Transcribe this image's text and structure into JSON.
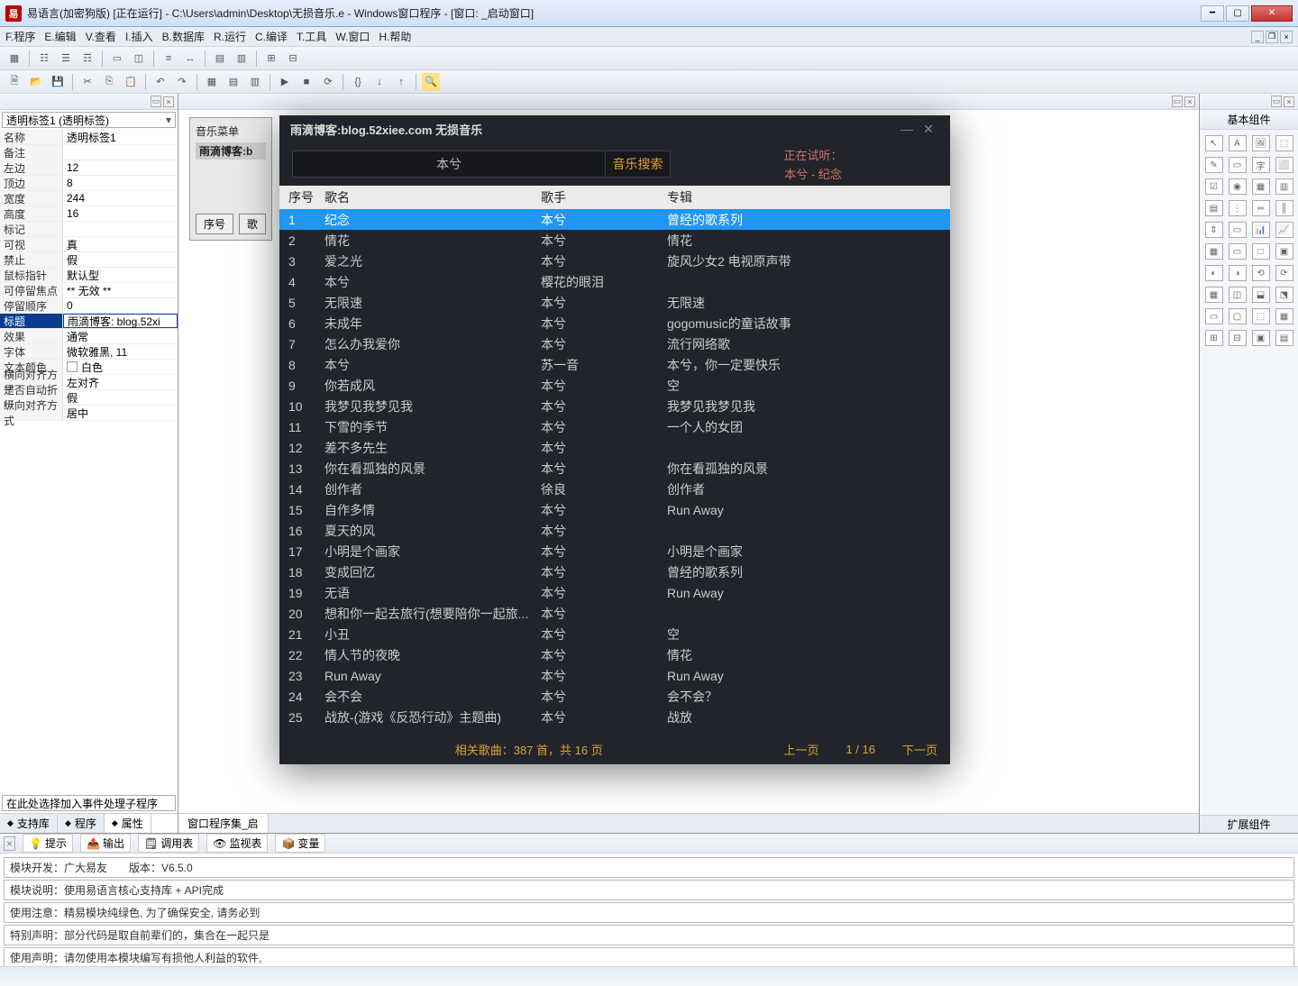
{
  "titlebar": {
    "icon_text": "易",
    "title": "易语言(加密狗版) [正在运行] - C:\\Users\\admin\\Desktop\\无损音乐.e - Windows窗口程序 - [窗口: _启动窗口]"
  },
  "menubar": {
    "items": [
      "F.程序",
      "E.编辑",
      "V.查看",
      "I.插入",
      "B.数据库",
      "R.运行",
      "C.编译",
      "T.工具",
      "W.窗口",
      "H.帮助"
    ]
  },
  "left_panel": {
    "combo": "透明标签1 (透明标签)",
    "rows": [
      {
        "k": "名称",
        "v": "透明标签1"
      },
      {
        "k": "备注",
        "v": ""
      },
      {
        "k": "左边",
        "v": "12"
      },
      {
        "k": "顶边",
        "v": "8"
      },
      {
        "k": "宽度",
        "v": "244"
      },
      {
        "k": "高度",
        "v": "16"
      },
      {
        "k": "标记",
        "v": ""
      },
      {
        "k": "可视",
        "v": "真"
      },
      {
        "k": "禁止",
        "v": "假"
      },
      {
        "k": "鼠标指针",
        "v": "默认型"
      },
      {
        "k": "可停留焦点",
        "v": "** 无效 **"
      },
      {
        "k": "停留顺序",
        "v": "0"
      },
      {
        "k": "标题",
        "v": "雨滴博客: blog.52xi",
        "sel": true
      },
      {
        "k": "效果",
        "v": "通常"
      },
      {
        "k": "字体",
        "v": "微软雅黑, 11"
      },
      {
        "k": "文本颜色",
        "v": "白色",
        "swatch": "#ffffff"
      },
      {
        "k": "横向对齐方式",
        "v": "左对齐"
      },
      {
        "k": "是否自动折行",
        "v": "假"
      },
      {
        "k": "纵向对齐方式",
        "v": "居中"
      }
    ],
    "bottom_combo": "在此处选择加入事件处理子程序",
    "tabs": [
      "支持库",
      "程序",
      "属性"
    ]
  },
  "center": {
    "design_label1": "音乐菜单",
    "design_label2": "雨滴博客:b",
    "extra": [
      "序号",
      "歌"
    ],
    "tab": "窗口程序集_启"
  },
  "right_palette": {
    "title": "基本组件",
    "count": 40,
    "footer": "扩展组件"
  },
  "bottom": {
    "tabs": [
      "提示",
      "输出",
      "调用表",
      "监视表",
      "变量"
    ],
    "rows": [
      "模块开发：广大易友　　版本：V6.5.0",
      "模块说明：使用易语言核心支持库 + API完成",
      "使用注意：精易模块纯绿色, 为了确保安全, 请务必到",
      "特别声明：部分代码是取自前辈们的，集合在一起只是",
      "使用声明：请勿使用本模块编写有损他人利益的软件,"
    ]
  },
  "player": {
    "title": "雨滴博客:blog.52xiee.com 无损音乐",
    "search_placeholder": "本兮",
    "search_btn": "音乐搜索",
    "now1": "正在试听：",
    "now2": "本兮 - 纪念",
    "headers": {
      "num": "序号",
      "name": "歌名",
      "singer": "歌手",
      "album": "专辑"
    },
    "songs": [
      {
        "n": "1",
        "name": "纪念",
        "singer": "本兮",
        "album": "曾经的歌系列",
        "sel": true
      },
      {
        "n": "2",
        "name": "情花",
        "singer": "本兮",
        "album": "情花"
      },
      {
        "n": "3",
        "name": "爱之光",
        "singer": "本兮",
        "album": "旋风少女2 电视原声带"
      },
      {
        "n": "4",
        "name": "本兮",
        "singer": "樱花的眼泪",
        "album": ""
      },
      {
        "n": "5",
        "name": "无限速",
        "singer": "本兮",
        "album": "无限速"
      },
      {
        "n": "6",
        "name": "未成年",
        "singer": "本兮",
        "album": "gogomusic的童话故事"
      },
      {
        "n": "7",
        "name": "怎么办我爱你",
        "singer": "本兮",
        "album": "流行网络歌"
      },
      {
        "n": "8",
        "name": "本兮",
        "singer": "苏一音",
        "album": "本兮，你一定要快乐"
      },
      {
        "n": "9",
        "name": "你若成风",
        "singer": "本兮",
        "album": "空"
      },
      {
        "n": "10",
        "name": "我梦见我梦见我",
        "singer": "本兮",
        "album": "我梦见我梦见我"
      },
      {
        "n": "11",
        "name": "下雪的季节",
        "singer": "本兮",
        "album": "一个人的女团"
      },
      {
        "n": "12",
        "name": "差不多先生",
        "singer": "本兮",
        "album": ""
      },
      {
        "n": "13",
        "name": "你在看孤独的风景",
        "singer": "本兮",
        "album": "你在看孤独的风景"
      },
      {
        "n": "14",
        "name": "创作者",
        "singer": "徐良",
        "album": "创作者"
      },
      {
        "n": "15",
        "name": "自作多情",
        "singer": "本兮",
        "album": "Run Away"
      },
      {
        "n": "16",
        "name": "夏天的风",
        "singer": "本兮",
        "album": ""
      },
      {
        "n": "17",
        "name": "小明是个画家",
        "singer": "本兮",
        "album": "小明是个画家"
      },
      {
        "n": "18",
        "name": "变成回忆",
        "singer": "本兮",
        "album": "曾经的歌系列"
      },
      {
        "n": "19",
        "name": "无语",
        "singer": "本兮",
        "album": "Run Away"
      },
      {
        "n": "20",
        "name": "想和你一起去旅行(想要陪你一起旅...",
        "singer": "本兮",
        "album": ""
      },
      {
        "n": "21",
        "name": "小丑",
        "singer": "本兮",
        "album": "空"
      },
      {
        "n": "22",
        "name": "情人节的夜晚",
        "singer": "本兮",
        "album": "情花"
      },
      {
        "n": "23",
        "name": "Run Away",
        "singer": "本兮",
        "album": "Run Away"
      },
      {
        "n": "24",
        "name": "会不会",
        "singer": "本兮",
        "album": "会不会？"
      },
      {
        "n": "25",
        "name": "战放-(游戏《反恐行动》主题曲)",
        "singer": "本兮",
        "album": "战放"
      }
    ],
    "footer_info": "相关歌曲：387 首，共 16 页",
    "prev": "上一页",
    "pagenum": "1 / 16",
    "next": "下一页"
  }
}
